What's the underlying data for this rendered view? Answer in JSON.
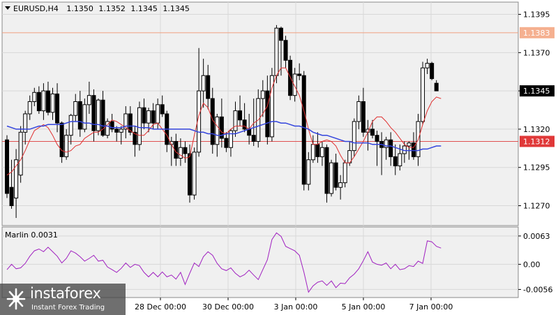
{
  "header": {
    "symbol": "EURUSD,H4",
    "open": "1.1350",
    "high": "1.1352",
    "low": "1.1345",
    "close": "1.1345"
  },
  "indicator": {
    "label": "Marlin 0.0031"
  },
  "price_tags": {
    "resistance": "1.1383",
    "current": "1.1345",
    "support": "1.1312"
  },
  "branding": {
    "name": "instaforex",
    "tagline": "Instant Forex Trading"
  },
  "colors": {
    "background": "#ffffff",
    "plot_background": "#f0f0f0",
    "grid": "#d8d8d8",
    "candle": "#000000",
    "fast_ma": "#e03030",
    "slow_ma": "#3344dd",
    "oscillator": "#a020c0",
    "resistance_line": "#f0a080",
    "support_line": "#e05050",
    "resistance_tag": "#f5b090",
    "support_tag": "#e03838"
  },
  "chart_data": [
    {
      "type": "candlestick",
      "title": "EURUSD,H4",
      "ylim": [
        1.1257,
        1.1403
      ],
      "y_ticks": [
        "1.1395",
        "1.1370",
        "1.1345",
        "1.1320",
        "1.1295",
        "1.1270"
      ],
      "x_tick_labels": [
        "28 Dec 00:00",
        "30 Dec 00:00",
        "3 Jan 00:00",
        "5 Jan 00:00",
        "7 Jan 00:00"
      ],
      "levels": [
        {
          "name": "resistance",
          "value": 1.1383
        },
        {
          "name": "support",
          "value": 1.1312
        }
      ],
      "current_price": 1.1345,
      "candles": [
        [
          1.1313,
          1.1316,
          1.1275,
          1.1278
        ],
        [
          1.1282,
          1.13,
          1.1268,
          1.127
        ],
        [
          1.1275,
          1.1307,
          1.1262,
          1.13
        ],
        [
          1.129,
          1.1322,
          1.1285,
          1.1318
        ],
        [
          1.1318,
          1.1332,
          1.131,
          1.133
        ],
        [
          1.133,
          1.1342,
          1.1326,
          1.1338
        ],
        [
          1.1338,
          1.1347,
          1.1335,
          1.1344
        ],
        [
          1.1344,
          1.1348,
          1.133,
          1.1332
        ],
        [
          1.1332,
          1.135,
          1.1326,
          1.1345
        ],
        [
          1.1345,
          1.1351,
          1.1329,
          1.1331
        ],
        [
          1.1331,
          1.1347,
          1.1326,
          1.1343
        ],
        [
          1.1343,
          1.135,
          1.1318,
          1.1324
        ],
        [
          1.1324,
          1.1325,
          1.1298,
          1.1302
        ],
        [
          1.1302,
          1.132,
          1.13,
          1.1316
        ],
        [
          1.1316,
          1.133,
          1.131,
          1.1329
        ],
        [
          1.1329,
          1.1343,
          1.1325,
          1.1338
        ],
        [
          1.1338,
          1.1345,
          1.1315,
          1.132
        ],
        [
          1.132,
          1.134,
          1.1318,
          1.1336
        ],
        [
          1.1336,
          1.1351,
          1.133,
          1.1342
        ],
        [
          1.1342,
          1.1346,
          1.1312,
          1.1319
        ],
        [
          1.1319,
          1.134,
          1.1316,
          1.1339
        ],
        [
          1.1339,
          1.1345,
          1.1315,
          1.1316
        ],
        [
          1.1316,
          1.1327,
          1.1314,
          1.1325
        ],
        [
          1.1325,
          1.133,
          1.1318,
          1.132
        ],
        [
          1.132,
          1.1322,
          1.1312,
          1.1318
        ],
        [
          1.1318,
          1.1322,
          1.131,
          1.132
        ],
        [
          1.132,
          1.1335,
          1.1314,
          1.133
        ],
        [
          1.133,
          1.1335,
          1.1316,
          1.1318
        ],
        [
          1.1318,
          1.1322,
          1.1302,
          1.131
        ],
        [
          1.131,
          1.1338,
          1.1306,
          1.1334
        ],
        [
          1.1334,
          1.134,
          1.132,
          1.1324
        ],
        [
          1.1324,
          1.1334,
          1.1318,
          1.1332
        ],
        [
          1.1332,
          1.1337,
          1.132,
          1.1324
        ],
        [
          1.1324,
          1.134,
          1.132,
          1.1336
        ],
        [
          1.1336,
          1.1342,
          1.1328,
          1.133
        ],
        [
          1.133,
          1.1332,
          1.1305,
          1.131
        ],
        [
          1.131,
          1.1315,
          1.1296,
          1.1312
        ],
        [
          1.1312,
          1.1317,
          1.1296,
          1.1301
        ],
        [
          1.1301,
          1.1314,
          1.1296,
          1.1308
        ],
        [
          1.1308,
          1.1312,
          1.1298,
          1.1304
        ],
        [
          1.1304,
          1.131,
          1.1272,
          1.1277
        ],
        [
          1.1277,
          1.1308,
          1.1274,
          1.1305
        ],
        [
          1.1305,
          1.1373,
          1.1302,
          1.1345
        ],
        [
          1.1345,
          1.1366,
          1.1334,
          1.1355
        ],
        [
          1.1355,
          1.1362,
          1.1333,
          1.134
        ],
        [
          1.134,
          1.1347,
          1.1304,
          1.131
        ],
        [
          1.131,
          1.133,
          1.1302,
          1.1328
        ],
        [
          1.1328,
          1.134,
          1.1308,
          1.1314
        ],
        [
          1.1314,
          1.1318,
          1.1305,
          1.1308
        ],
        [
          1.1308,
          1.132,
          1.1302,
          1.1319
        ],
        [
          1.1319,
          1.1338,
          1.1315,
          1.1332
        ],
        [
          1.1332,
          1.1342,
          1.1322,
          1.1326
        ],
        [
          1.1326,
          1.1337,
          1.1318,
          1.132
        ],
        [
          1.132,
          1.133,
          1.131,
          1.1316
        ],
        [
          1.1316,
          1.134,
          1.1309,
          1.1312
        ],
        [
          1.1312,
          1.1346,
          1.1308,
          1.134
        ],
        [
          1.134,
          1.1352,
          1.1328,
          1.1345
        ],
        [
          1.1345,
          1.1355,
          1.131,
          1.1315
        ],
        [
          1.1315,
          1.136,
          1.1312,
          1.1355
        ],
        [
          1.1355,
          1.1388,
          1.135,
          1.1386
        ],
        [
          1.1386,
          1.1387,
          1.1355,
          1.1378
        ],
        [
          1.1378,
          1.1381,
          1.136,
          1.1365
        ],
        [
          1.1365,
          1.1368,
          1.1339,
          1.1342
        ],
        [
          1.1342,
          1.136,
          1.1338,
          1.1356
        ],
        [
          1.1356,
          1.1363,
          1.1352,
          1.1355
        ],
        [
          1.1355,
          1.1358,
          1.128,
          1.1284
        ],
        [
          1.1284,
          1.1305,
          1.128,
          1.13
        ],
        [
          1.13,
          1.1316,
          1.1298,
          1.131
        ],
        [
          1.131,
          1.1318,
          1.1298,
          1.1302
        ],
        [
          1.1302,
          1.1312,
          1.1296,
          1.1308
        ],
        [
          1.1308,
          1.131,
          1.1272,
          1.1278
        ],
        [
          1.1278,
          1.13,
          1.1276,
          1.1298
        ],
        [
          1.1298,
          1.1304,
          1.128,
          1.1282
        ],
        [
          1.1282,
          1.129,
          1.1274,
          1.1285
        ],
        [
          1.1285,
          1.13,
          1.1282,
          1.1298
        ],
        [
          1.1298,
          1.1312,
          1.1296,
          1.1306
        ],
        [
          1.1306,
          1.1327,
          1.1302,
          1.1325
        ],
        [
          1.1325,
          1.1342,
          1.132,
          1.1338
        ],
        [
          1.1338,
          1.1347,
          1.1315,
          1.1318
        ],
        [
          1.1318,
          1.1326,
          1.1306,
          1.132
        ],
        [
          1.132,
          1.1326,
          1.1314,
          1.1316
        ],
        [
          1.1316,
          1.1319,
          1.1296,
          1.1312
        ],
        [
          1.1312,
          1.1318,
          1.129,
          1.1308
        ],
        [
          1.1308,
          1.1315,
          1.13,
          1.1313
        ],
        [
          1.1313,
          1.1318,
          1.1296,
          1.1302
        ],
        [
          1.1302,
          1.131,
          1.129,
          1.1296
        ],
        [
          1.1296,
          1.131,
          1.1293,
          1.1304
        ],
        [
          1.1304,
          1.1312,
          1.1298,
          1.1309
        ],
        [
          1.1309,
          1.1312,
          1.13,
          1.1311
        ],
        [
          1.1311,
          1.1318,
          1.13,
          1.1302
        ],
        [
          1.1302,
          1.133,
          1.1296,
          1.1325
        ],
        [
          1.1325,
          1.1364,
          1.1323,
          1.136
        ],
        [
          1.136,
          1.1366,
          1.1356,
          1.1363
        ],
        [
          1.1363,
          1.1364,
          1.1352,
          1.1353
        ],
        [
          1.135,
          1.1352,
          1.1345,
          1.1345
        ]
      ],
      "series": [
        {
          "name": "fast MA",
          "values": [
            1.129,
            1.1292,
            1.1296,
            1.13,
            1.1306,
            1.1313,
            1.1319,
            1.1321,
            1.1323,
            1.1321,
            1.1316,
            1.131,
            1.1306,
            1.1305,
            1.1306,
            1.1309,
            1.131,
            1.1314,
            1.1316,
            1.1318,
            1.1318,
            1.132,
            1.1323,
            1.1326,
            1.1325,
            1.1323,
            1.1321,
            1.1319,
            1.1317,
            1.1316,
            1.1316,
            1.1319,
            1.1323,
            1.1324,
            1.132,
            1.1316,
            1.131,
            1.1305,
            1.1303,
            1.1301,
            1.1302,
            1.1316,
            1.1329,
            1.1337,
            1.1334,
            1.1326,
            1.1322,
            1.1318,
            1.1317,
            1.132,
            1.1322,
            1.1322,
            1.1322,
            1.132,
            1.1324,
            1.1326,
            1.133,
            1.1335,
            1.1347,
            1.1355,
            1.136,
            1.136,
            1.1354,
            1.1348,
            1.1342,
            1.1332,
            1.132,
            1.131,
            1.131,
            1.1312,
            1.1313,
            1.1312,
            1.1309,
            1.1303,
            1.1298,
            1.1298,
            1.1302,
            1.1307,
            1.1312,
            1.1318,
            1.1325,
            1.1328,
            1.1328,
            1.1325,
            1.1321,
            1.1318,
            1.1314,
            1.131,
            1.1308,
            1.1308,
            1.1313,
            1.1323,
            1.1332,
            1.1338,
            1.1341,
            1.134
          ]
        },
        {
          "name": "slow MA",
          "values": [
            1.1322,
            1.1321,
            1.132,
            1.132,
            1.132,
            1.132,
            1.1321,
            1.1322,
            1.1322,
            1.1323,
            1.1323,
            1.1323,
            1.1323,
            1.1324,
            1.1325,
            1.1325,
            1.1325,
            1.1324,
            1.1324,
            1.1323,
            1.1323,
            1.1322,
            1.1322,
            1.1321,
            1.1321,
            1.1321,
            1.1322,
            1.1322,
            1.1322,
            1.1321,
            1.1321,
            1.1321,
            1.132,
            1.132,
            1.132,
            1.132,
            1.132,
            1.132,
            1.132,
            1.132,
            1.132,
            1.1319,
            1.1318,
            1.1318,
            1.1317,
            1.1317,
            1.1316,
            1.1316,
            1.1317,
            1.1317,
            1.1317,
            1.1318,
            1.1319,
            1.132,
            1.1321,
            1.1322,
            1.1323,
            1.1324,
            1.1325,
            1.1325,
            1.1324,
            1.1324,
            1.1323,
            1.1322,
            1.1322,
            1.1321,
            1.132,
            1.1318,
            1.1317,
            1.1316,
            1.1316,
            1.1315,
            1.1314,
            1.1313,
            1.1312,
            1.1312,
            1.1311,
            1.1311,
            1.1311,
            1.1311,
            1.131,
            1.131,
            1.131,
            1.1309,
            1.1309,
            1.1308,
            1.1307,
            1.1306,
            1.1306,
            1.1306,
            1.1306,
            1.1307,
            1.1307,
            1.1308,
            1.1309,
            1.1309
          ]
        }
      ]
    },
    {
      "type": "line",
      "title": "Marlin 0.0031",
      "ylim": [
        -0.0074,
        0.0083
      ],
      "y_ticks": [
        "0.0063",
        "0.00",
        "-0.0056"
      ],
      "x_tick_labels": [
        "28 Dec 00:00",
        "30 Dec 00:00",
        "3 Jan 00:00",
        "5 Jan 00:00",
        "7 Jan 00:00"
      ],
      "series": [
        {
          "name": "Marlin",
          "values": [
            -0.0012,
            0.0,
            -0.001,
            -0.0008,
            0.0002,
            0.0018,
            0.003,
            0.0034,
            0.0028,
            0.0038,
            0.0028,
            0.0018,
            0.0003,
            0.0013,
            0.003,
            0.0025,
            0.0017,
            0.0007,
            0.0013,
            0.002,
            0.0007,
            0.0009,
            -0.0006,
            -0.0012,
            -0.0018,
            -0.0009,
            0.0003,
            -0.0007,
            0.0,
            -0.0003,
            -0.0018,
            -0.0028,
            -0.0018,
            -0.0028,
            -0.0017,
            -0.0028,
            -0.0024,
            -0.0033,
            -0.0018,
            -0.0045,
            -0.002,
            0.0003,
            -0.0005,
            0.0017,
            0.0028,
            0.002,
            0.0002,
            -0.001,
            -0.0014,
            -0.0008,
            -0.002,
            -0.0028,
            -0.0023,
            -0.0013,
            -0.0024,
            -0.0034,
            -0.0012,
            0.001,
            0.0055,
            0.007,
            0.0062,
            0.004,
            0.0035,
            0.003,
            0.002,
            -0.0018,
            -0.0062,
            -0.0048,
            -0.004,
            -0.0037,
            -0.0047,
            -0.0037,
            -0.0052,
            -0.0042,
            -0.0043,
            -0.003,
            -0.0022,
            -0.001,
            0.0008,
            0.0028,
            0.0005,
            0.0,
            -0.0002,
            0.0003,
            -0.001,
            0.0,
            -0.0012,
            -0.001,
            -0.0003,
            -0.0005,
            0.0007,
            0.0002,
            0.0052,
            0.005,
            0.004,
            0.0036
          ]
        }
      ]
    }
  ]
}
